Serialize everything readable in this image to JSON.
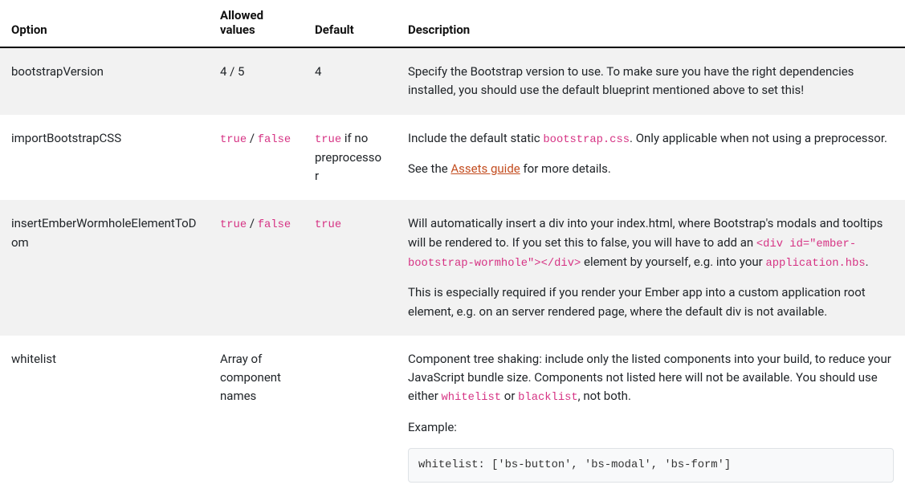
{
  "headers": {
    "option": "Option",
    "allowed": "Allowed values",
    "default": "Default",
    "description": "Description"
  },
  "rows": [
    {
      "option": "bootstrapVersion",
      "allowed_plain": "4 / 5",
      "default_plain": "4",
      "desc": [
        {
          "type": "p",
          "parts": [
            {
              "t": "text",
              "v": "Specify the Bootstrap version to use. To make sure you have the right dependencies installed, you should use the default blueprint mentioned above to set this!"
            }
          ]
        }
      ]
    },
    {
      "option": "importBootstrapCSS",
      "allowed_codes": [
        "true",
        "false"
      ],
      "default_code_prefix": "true",
      "default_plain_suffix": " if no preprocessor",
      "desc": [
        {
          "type": "p",
          "parts": [
            {
              "t": "text",
              "v": "Include the default static "
            },
            {
              "t": "code",
              "v": "bootstrap.css"
            },
            {
              "t": "text",
              "v": ". Only applicable when not using a preprocessor."
            }
          ]
        },
        {
          "type": "p",
          "parts": [
            {
              "t": "text",
              "v": "See the "
            },
            {
              "t": "link",
              "v": "Assets guide"
            },
            {
              "t": "text",
              "v": " for more details."
            }
          ]
        }
      ]
    },
    {
      "option": "insertEmberWormholeElementToDom",
      "allowed_codes": [
        "true",
        "false"
      ],
      "default_code": "true",
      "desc": [
        {
          "type": "p",
          "parts": [
            {
              "t": "text",
              "v": "Will automatically insert a div into your index.html, where Bootstrap's modals and tooltips will be rendered to. If you set this to false, you will have to add an "
            },
            {
              "t": "code",
              "v": "<div id=\"ember-bootstrap-wormhole\"></div>"
            },
            {
              "t": "text",
              "v": " element by yourself, e.g. into your "
            },
            {
              "t": "code",
              "v": "application.hbs"
            },
            {
              "t": "text",
              "v": "."
            }
          ]
        },
        {
          "type": "p",
          "parts": [
            {
              "t": "text",
              "v": "This is especially required if you render your Ember app into a custom application root element, e.g. on an server rendered page, where the default div is not available."
            }
          ]
        }
      ]
    },
    {
      "option": "whitelist",
      "allowed_plain": "Array of component names",
      "default_plain": "",
      "desc": [
        {
          "type": "p",
          "parts": [
            {
              "t": "text",
              "v": "Component tree shaking: include only the listed components into your build, to reduce your JavaScript bundle size. Components not listed here will not be available. You should use either "
            },
            {
              "t": "code",
              "v": "whitelist"
            },
            {
              "t": "text",
              "v": " or "
            },
            {
              "t": "code",
              "v": "blacklist"
            },
            {
              "t": "text",
              "v": ", not both."
            }
          ]
        },
        {
          "type": "p",
          "parts": [
            {
              "t": "text",
              "v": "Example:"
            }
          ]
        },
        {
          "type": "pre",
          "v": "whitelist: ['bs-button', 'bs-modal', 'bs-form']"
        }
      ]
    }
  ]
}
